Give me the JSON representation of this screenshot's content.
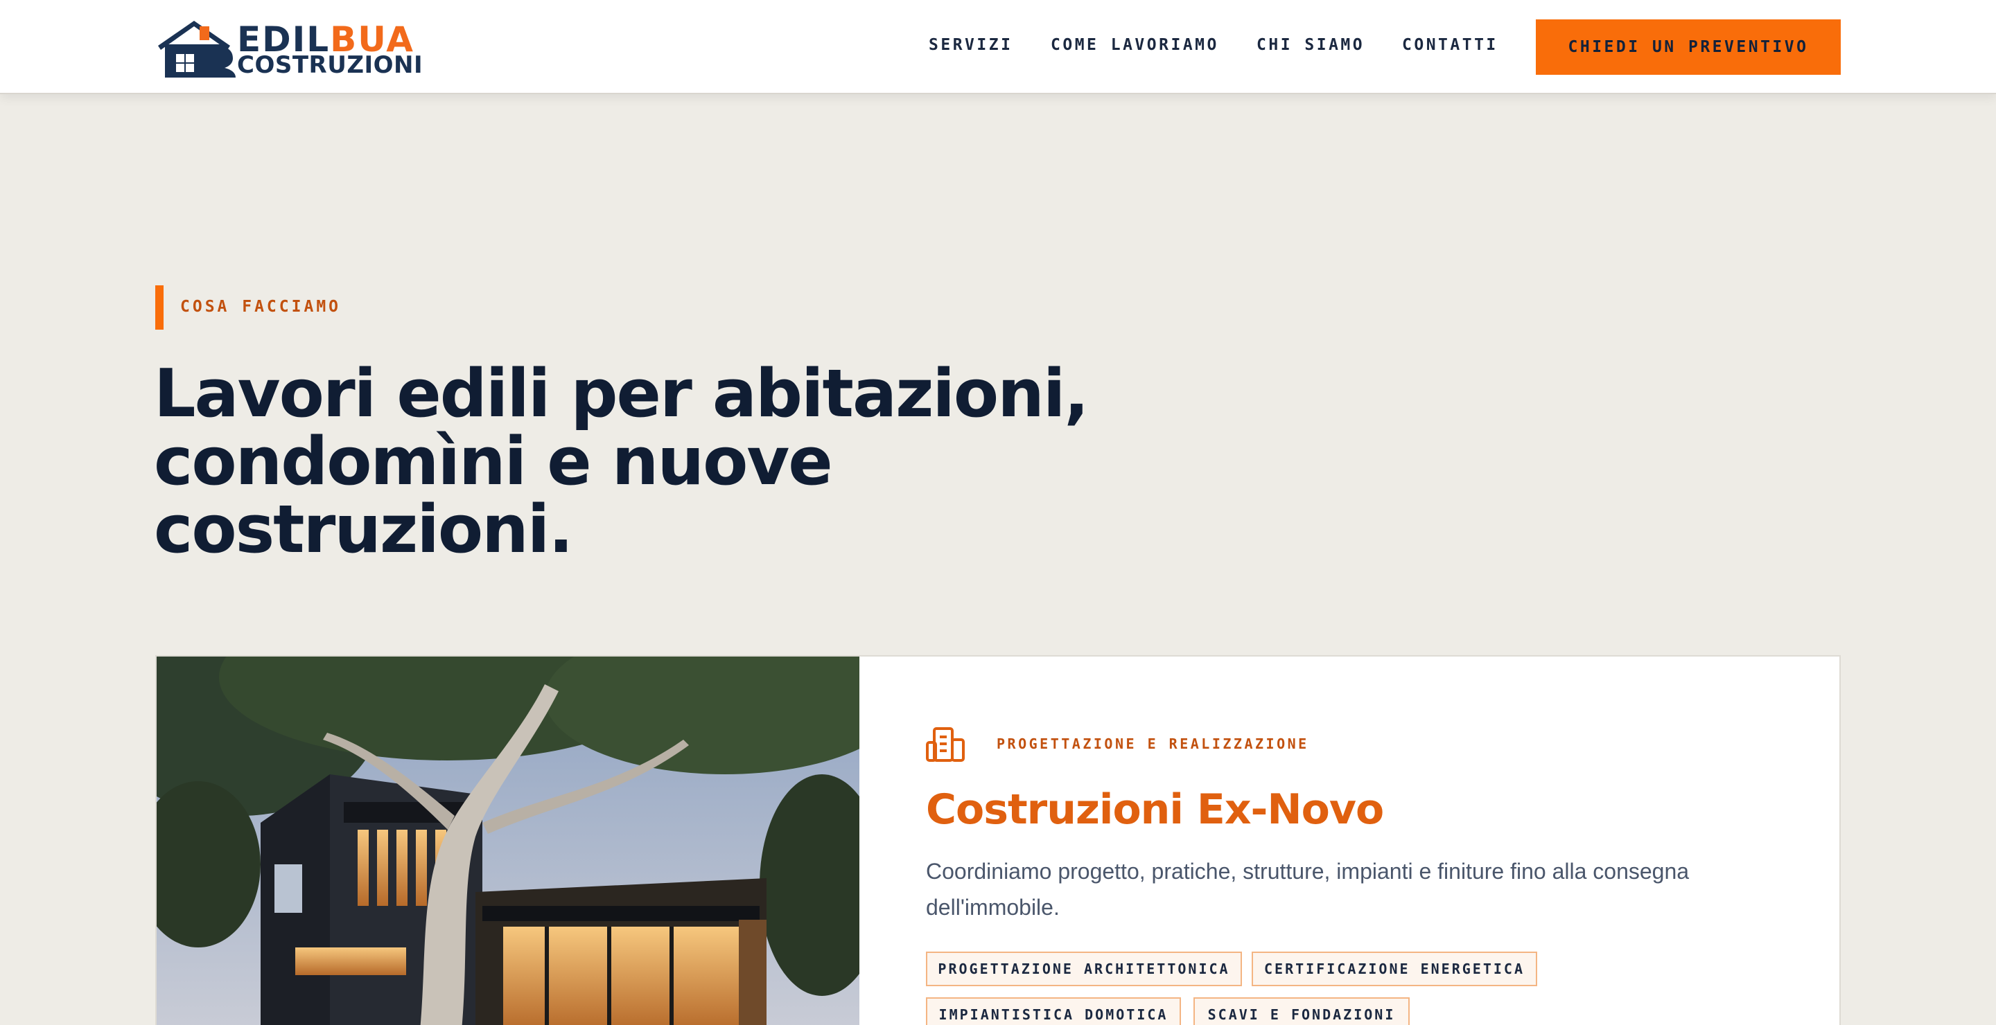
{
  "brand": {
    "name_part1": "EDIL",
    "name_part2": "BUA",
    "name_line2": "COSTRUZIONI",
    "logo_icon": "house-logo-icon",
    "colors": {
      "navy": "#1a3253",
      "orange": "#f26a1b"
    }
  },
  "nav": {
    "items": [
      "SERVIZI",
      "COME LAVORIAMO",
      "CHI SIAMO",
      "CONTATTI"
    ],
    "cta": "CHIEDI UN PREVENTIVO"
  },
  "section": {
    "eyebrow": "COSA FACCIAMO",
    "headline": "Lavori edili per abitazioni, condomìni e nuove costruzioni."
  },
  "service": {
    "icon": "building-icon",
    "kicker": "PROGETTAZIONE E REALIZZAZIONE",
    "title": "Costruzioni Ex-Novo",
    "description": "Coordiniamo progetto, pratiche, strutture, impianti e finiture fino alla consegna dell'immobile.",
    "tags": [
      "PROGETTAZIONE ARCHITETTONICA",
      "CERTIFICAZIONE ENERGETICA",
      "IMPIANTISTICA DOMOTICA",
      "SCAVI E FONDAZIONI"
    ],
    "image": "modern-house-photo"
  },
  "colors": {
    "accent": "#f96d0a",
    "background": "#eeece6",
    "text": "#101d33"
  }
}
